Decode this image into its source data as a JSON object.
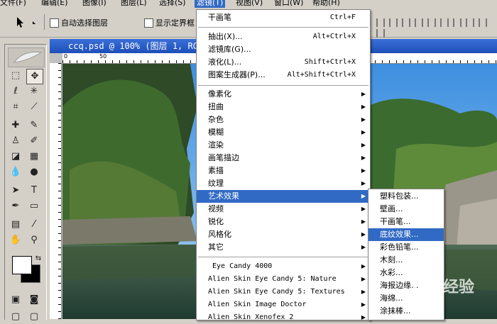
{
  "menubar": {
    "items": [
      {
        "label": "文件(F)"
      },
      {
        "label": "编辑(E)"
      },
      {
        "label": "图像(I)"
      },
      {
        "label": "图层(L)"
      },
      {
        "label": "选择(S)"
      },
      {
        "label": "滤镜(T)"
      },
      {
        "label": "视图(V)"
      },
      {
        "label": "窗口(W)"
      },
      {
        "label": "帮助(H)"
      }
    ]
  },
  "options_bar": {
    "auto_select_label": "自动选择图层",
    "show_bounds_label": "显示定界框"
  },
  "document": {
    "title": "ccq.psd @ 100% (图层 1, RGB/8)",
    "ruler_labels": [
      "0",
      "50"
    ]
  },
  "filter_menu": {
    "last_filter": {
      "label": "干画笔",
      "shortcut": "Ctrl+F"
    },
    "group1": [
      {
        "label": "抽出(X)...",
        "shortcut": "Alt+Ctrl+X"
      },
      {
        "label": "滤镜库(G)..."
      },
      {
        "label": "液化(L)...",
        "shortcut": "Shift+Ctrl+X"
      },
      {
        "label": "图案生成器(P)...",
        "shortcut": "Alt+Shift+Ctrl+X"
      }
    ],
    "group2": [
      {
        "label": "像素化"
      },
      {
        "label": "扭曲"
      },
      {
        "label": "杂色"
      },
      {
        "label": "模糊"
      },
      {
        "label": "渲染"
      },
      {
        "label": "画笔描边"
      },
      {
        "label": "素描"
      },
      {
        "label": "纹理"
      },
      {
        "label": "艺术效果"
      },
      {
        "label": "视频"
      },
      {
        "label": "锐化"
      },
      {
        "label": "风格化"
      },
      {
        "label": "其它"
      }
    ],
    "highlighted": "艺术效果",
    "plugins": [
      {
        "label": "Eye Candy 4000"
      },
      {
        "label": "Alien Skin Eye Candy 5: Nature"
      },
      {
        "label": "Alien Skin Eye Candy 5: Textures"
      },
      {
        "label": "Alien Skin Image Doctor"
      },
      {
        "label": "Alien Skin Xenofex 2"
      }
    ]
  },
  "artistic_submenu": {
    "items": [
      {
        "label": "塑料包装..."
      },
      {
        "label": "壁画..."
      },
      {
        "label": "干画笔..."
      },
      {
        "label": "底纹效果..."
      },
      {
        "label": "彩色铅笔..."
      },
      {
        "label": "木刻..."
      },
      {
        "label": "水彩..."
      },
      {
        "label": "海报边缘..."
      },
      {
        "label": "海绵..."
      },
      {
        "label": "涂抹棒..."
      }
    ],
    "highlighted": "底纹效果..."
  },
  "watermark": {
    "text": "经验"
  },
  "colors": {
    "menu_highlight": "#316ac5",
    "chrome": "#d4d0c8",
    "title_bar": "#2a5fc8"
  }
}
